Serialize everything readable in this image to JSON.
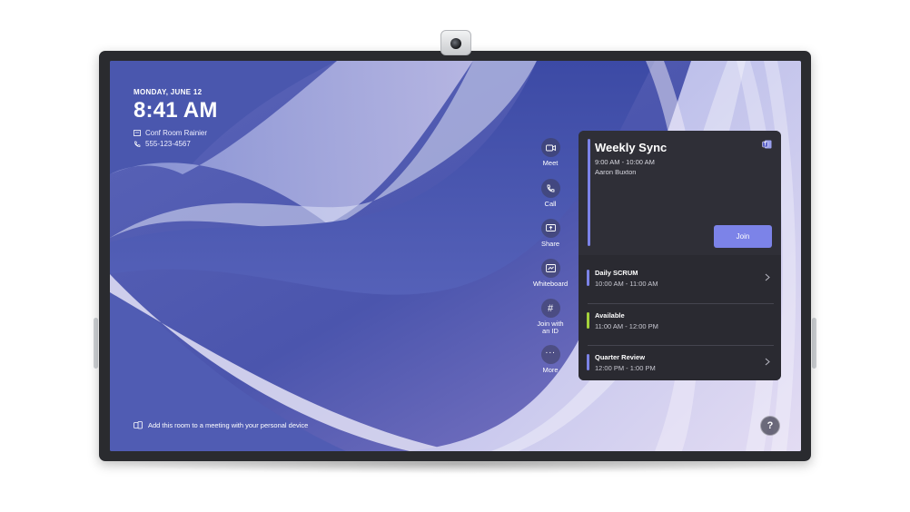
{
  "header": {
    "date": "MONDAY, JUNE 12",
    "time": "8:41 AM",
    "room": "Conf Room Rainier",
    "phone": "555-123-4567"
  },
  "actions": [
    {
      "label": "Meet",
      "icon": "video-camera-icon"
    },
    {
      "label": "Call",
      "icon": "phone-icon"
    },
    {
      "label": "Share",
      "icon": "screen-share-icon"
    },
    {
      "label": "Whiteboard",
      "icon": "whiteboard-icon"
    },
    {
      "label": "Join with an ID",
      "icon": "hash-icon"
    },
    {
      "label": "More",
      "icon": "more-icon"
    }
  ],
  "featured_meeting": {
    "title": "Weekly Sync",
    "time": "9:00 AM - 10:00 AM",
    "organizer": "Aaron Buxton",
    "join_label": "Join",
    "icon": "teams-icon"
  },
  "meetings": [
    {
      "name": "Daily SCRUM",
      "time": "10:00 AM - 11:00 AM",
      "color": "#7c83e8",
      "has_chevron": true
    },
    {
      "name": "Available",
      "time": "11:00 AM - 12:00 PM",
      "color": "#a4d13b",
      "has_chevron": false
    },
    {
      "name": "Quarter Review",
      "time": "12:00 PM - 1:00 PM",
      "color": "#7c83e8",
      "has_chevron": true
    }
  ],
  "footer": {
    "text": "Add this room to a meeting with your personal device"
  },
  "help_label": "?",
  "colors": {
    "accent": "#7c83e8",
    "available": "#a4d13b",
    "panel": "#2f2f37"
  }
}
